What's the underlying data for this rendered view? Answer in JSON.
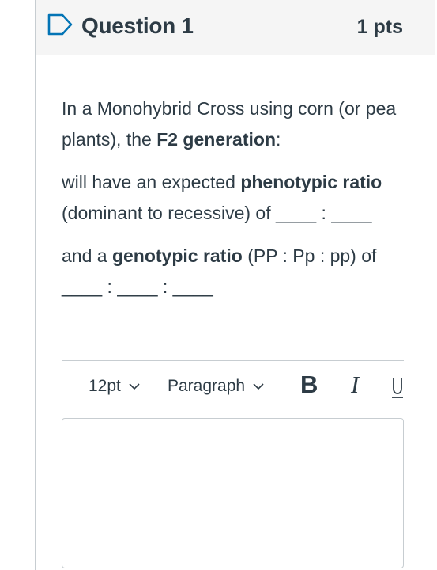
{
  "question": {
    "title": "Question 1",
    "points": "1 pts",
    "text": {
      "p1_a": "In  a Monohybrid Cross using  corn (or pea plants), the ",
      "p1_b": "F2 generation",
      "p1_c": ":",
      "p2_a": "will have an expected ",
      "p2_b": "phenotypic ratio",
      "p2_c": " (dominant to recessive) of ____ : ____",
      "p3_a": "and a ",
      "p3_b": "genotypic ratio",
      "p3_c": " (PP : Pp : pp) of ____ : ____ : ____"
    }
  },
  "toolbar": {
    "font_size": "12pt",
    "block_format": "Paragraph",
    "bold_label": "B",
    "italic_label": "I",
    "underline_label": "U"
  },
  "colors": {
    "text": "#2d3b45",
    "border": "#c7cdd1",
    "header_bg": "#f5f5f5",
    "flag": "#0374b5"
  }
}
